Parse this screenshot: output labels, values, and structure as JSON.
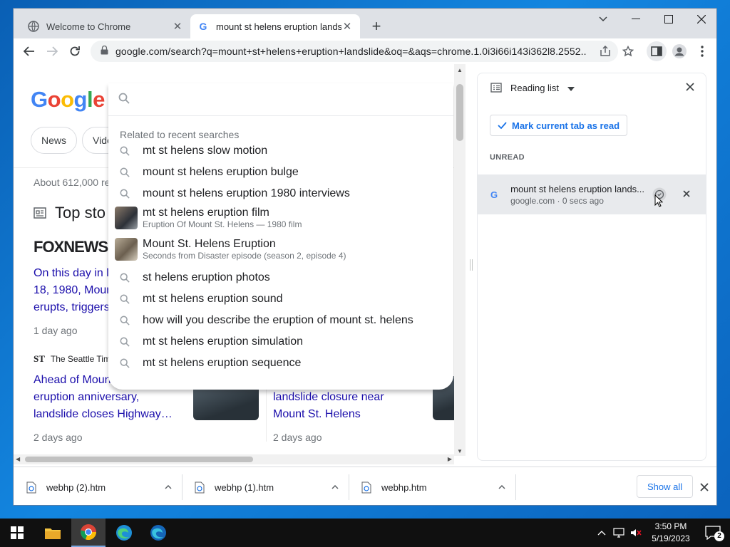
{
  "browser": {
    "tabs": [
      {
        "title": "Welcome to Chrome"
      },
      {
        "title": "mount st helens eruption landslide"
      }
    ],
    "address": "google.com/search?q=mount+st+helens+eruption+landslide&oq=&aqs=chrome.1.0i3i66i143i362l8.2552..."
  },
  "page": {
    "logo": "Google",
    "chips": [
      "News",
      "Vide"
    ],
    "results_count": "About 612,000 re",
    "top_stories": "Top sto",
    "story1": {
      "publisher": "FOXNEWS",
      "line1": "On this day in l",
      "line2": "18, 1980, Mour",
      "line3": "erupts, triggers",
      "ago": "1 day ago"
    },
    "story2": {
      "publisher": "The Seattle Tim",
      "line1": "Ahead of Moun",
      "line2": "eruption anniversary,",
      "line3": "landslide closes Highway…",
      "ago": "2 days ago"
    },
    "story3": {
      "line1": "landslide closure near",
      "line2": "Mount St. Helens",
      "ago": "2 days ago"
    }
  },
  "dropdown": {
    "related_label": "Related to recent searches",
    "suggestions": [
      {
        "text": "mt st helens slow motion"
      },
      {
        "text": "mount st helens eruption bulge"
      },
      {
        "text": "mount st helens eruption 1980 interviews"
      },
      {
        "text": "mt st helens eruption film",
        "sub": "Eruption Of Mount St. Helens — 1980 film"
      },
      {
        "text": "Mount St. Helens Eruption",
        "sub": "Seconds from Disaster episode (season 2, episode 4)"
      },
      {
        "text": "st helens eruption photos"
      },
      {
        "text": "mt st helens eruption sound"
      },
      {
        "text": "how will you describe the eruption of mount st. helens"
      },
      {
        "text": "mt st helens eruption simulation"
      },
      {
        "text": "mt st helens eruption sequence"
      }
    ]
  },
  "reading_list": {
    "header": "Reading list",
    "mark_button": "Mark current tab as read",
    "section": "UNREAD",
    "item": {
      "title": "mount st helens eruption lands...",
      "subtitle": "google.com · 0 secs ago"
    }
  },
  "downloads": {
    "items": [
      "webhp (2).htm",
      "webhp (1).htm",
      "webhp.htm"
    ],
    "show_all": "Show all"
  },
  "taskbar": {
    "time": "3:50 PM",
    "date": "5/19/2023",
    "notifications": "2"
  },
  "colors": {
    "accent": "#1a73e8",
    "link": "#1a0dab"
  }
}
